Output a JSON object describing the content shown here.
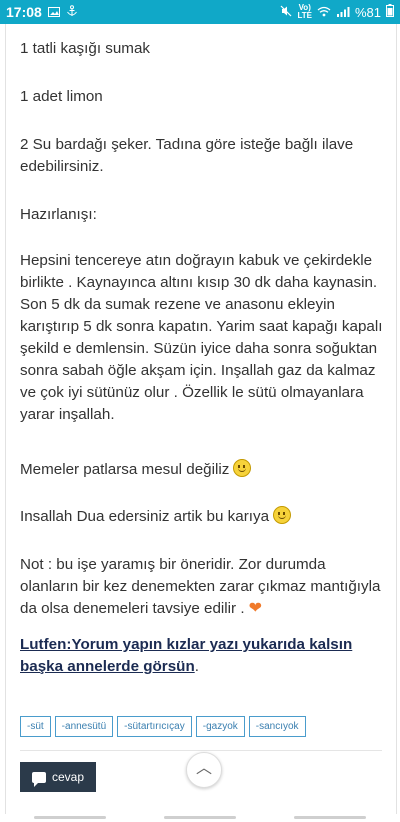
{
  "status_bar": {
    "time": "17:08",
    "network_top": "Vo)",
    "network_bottom": "LTE",
    "battery_percent": "%81",
    "icons": [
      "gallery-icon",
      "anchor-icon",
      "mute-icon",
      "wifi-icon",
      "signal-icon",
      "battery-icon"
    ]
  },
  "post": {
    "line1": "1 tatli kaşığı sumak",
    "line2": "1 adet limon",
    "line3": "2 Su bardağı şeker.  Tadına göre isteğe bağlı ilave edebilirsiniz.",
    "line4": "Hazırlanışı:",
    "line5": "Hepsini tencereye atın doğrayın kabuk ve çekirdekle birlikte . Kaynayınca altını kısıp 30 dk daha kaynasin. Son 5 dk da sumak rezene ve anasonu ekleyin karıştırıp 5 dk sonra kapatın.  Yarim saat kapağı kapalı şekild e demlensin.  Süzün iyice daha sonra soğuktan sonra sabah öğle akşam için.  Inşallah gaz da kalmaz ve çok iyi sütünüz olur . Özellik le sütü olmayanlara yarar inşallah.",
    "line6": "Memeler patlarsa mesul değiliz",
    "line7": "Insallah Dua edersiniz artik bu karıya",
    "line8": "Not : bu işe yaramış bir öneridir.  Zor durumda olanların bir kez denemekten zarar çıkmaz mantığıyla da olsa denemeleri tavsiye edilir .",
    "line9_link": "Lutfen:Yorum yapın kızlar yazı yukarıda kalsın başka annelerde görsün",
    "line9_suffix": "."
  },
  "tags": [
    "-süt",
    "-annesütü",
    "-sütartırıcıçay",
    "-gazyok",
    "-sancıyok"
  ],
  "actions": {
    "reply_label": "cevap",
    "scroll_top_glyph": "︿"
  },
  "colors": {
    "status_bar": "#10a8c8",
    "tag_border": "#4a9ccc",
    "reply_button": "#2b3a4a",
    "link_text": "#1b2b52"
  }
}
